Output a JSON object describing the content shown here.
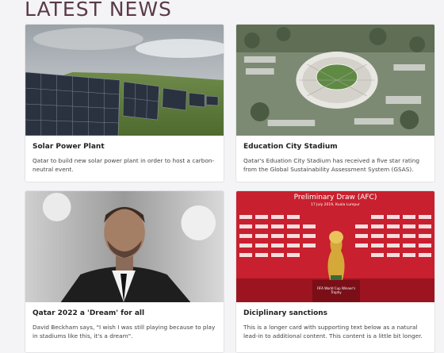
{
  "section": {
    "title": "LATEST NEWS"
  },
  "cards": [
    {
      "title": "Solar Power Plant",
      "text": "Qatar to build new solar power plant in order to host a carbon-neutral event."
    },
    {
      "title": "Education City Stadium",
      "text": "Qatar's Eduation City Stadium has received a five star rating from the Global Sustainability Assessment System (GSAS)."
    },
    {
      "title": "Qatar 2022 a 'Dream' for all",
      "text": "David Beckham says, \"I wish I was still playing because to play in stadiums like this, it's a dream\"."
    },
    {
      "title": "Diciplinary sanctions",
      "text": "This is a longer card with supporting text below as a natural lead-in to additional content. This content is a little bit longer."
    }
  ],
  "draw_banner": {
    "heading": "Preliminary Draw (AFC)",
    "subheading": "17 July 2019, Kuala Lumpur",
    "trophy_caption": "FIFA World Cup Winner's Trophy"
  },
  "colors": {
    "title": "#5a3a48",
    "card_bg": "#ffffff",
    "page_bg": "#f4f4f6",
    "banner_red": "#c8202e"
  }
}
